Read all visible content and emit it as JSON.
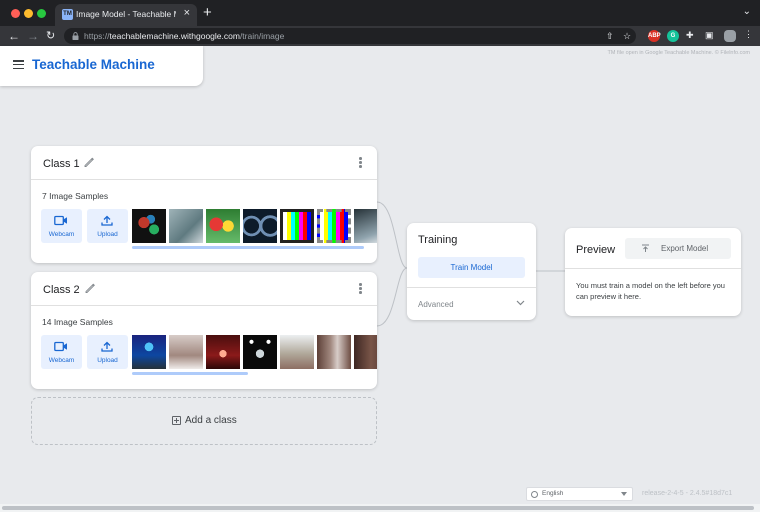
{
  "browser": {
    "tab_title": "Image Model - Teachable Machi",
    "tab_favicon": "TM",
    "url_scheme": "https://",
    "url_host": "teachablemachine.withgoogle.com",
    "url_path": "/train/image",
    "extension_badge": "ABP",
    "extension_g": "G"
  },
  "app": {
    "brand": "Teachable Machine",
    "watermark": "TM file open in Google Teachable Machine. © Filelnfo.com"
  },
  "classes": [
    {
      "name": "Class 1",
      "samples": "7 Image Samples",
      "webcam_label": "Webcam",
      "upload_label": "Upload"
    },
    {
      "name": "Class 2",
      "samples": "14 Image Samples",
      "webcam_label": "Webcam",
      "upload_label": "Upload"
    }
  ],
  "add_class_label": "Add a class",
  "training": {
    "title": "Training",
    "train_button": "Train Model",
    "advanced_label": "Advanced"
  },
  "preview": {
    "title": "Preview",
    "export_button": "Export Model",
    "message": "You must train a model on the left before you can preview it here."
  },
  "footer": {
    "language": "English",
    "version": "release-2-4-5 - 2.4.5#18d7c1"
  },
  "colors": {
    "accent": "#1967d2",
    "accent_light": "#e8f0fe",
    "page_bg": "#e8eaed"
  }
}
